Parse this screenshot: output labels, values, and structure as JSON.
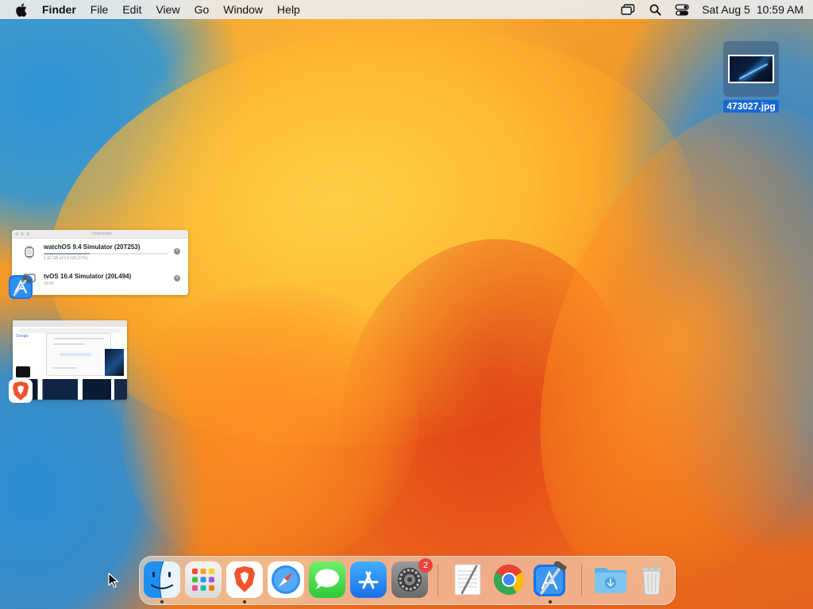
{
  "menubar": {
    "app_name": "Finder",
    "menus": [
      "File",
      "Edit",
      "View",
      "Go",
      "Window",
      "Help"
    ],
    "status_icons": [
      "screen-mirroring-icon",
      "spotlight-search-icon",
      "control-center-icon"
    ],
    "clock": {
      "date": "Sat Aug 5",
      "time": "10:59 AM"
    }
  },
  "desktop": {
    "file": {
      "name": "473027.jpg",
      "icon": "image-thumbnail-icon"
    }
  },
  "minimized_windows": {
    "downloads": {
      "title": "Downloads",
      "items": [
        {
          "name": "watchOS 9.4 Simulator (20T253)",
          "detail": "1.32 GB of 3.6 GB (37%)",
          "progress": 0.37,
          "icon": "apple-watch-icon"
        },
        {
          "name": "tvOS 16.4 Simulator (20L494)",
          "detail": "00:00",
          "progress": 0.0,
          "icon": "apple-tv-icon"
        }
      ],
      "app_badge": "xcode-icon"
    },
    "browser": {
      "logo_text": "Google",
      "app_badge": "brave-icon"
    }
  },
  "dock": {
    "apps": [
      {
        "name": "Finder",
        "icon": "finder-icon",
        "running": true
      },
      {
        "name": "Launchpad",
        "icon": "launchpad-icon",
        "running": false
      },
      {
        "name": "Brave Browser",
        "icon": "brave-icon",
        "running": true
      },
      {
        "name": "Safari",
        "icon": "safari-icon",
        "running": false
      },
      {
        "name": "Messages",
        "icon": "messages-icon",
        "running": false
      },
      {
        "name": "App Store",
        "icon": "app-store-icon",
        "running": false
      },
      {
        "name": "System Settings",
        "icon": "system-settings-icon",
        "running": false,
        "badge": "2"
      },
      {
        "name": "TextEdit",
        "icon": "textedit-icon",
        "running": false
      },
      {
        "name": "Google Chrome",
        "icon": "chrome-icon",
        "running": false
      },
      {
        "name": "Xcode",
        "icon": "xcode-icon",
        "running": true
      },
      {
        "name": "Downloads",
        "icon": "downloads-folder-icon",
        "running": false
      },
      {
        "name": "Trash",
        "icon": "trash-icon",
        "running": false
      }
    ]
  },
  "colors": {
    "menubar_bg": "#ececec",
    "selection_blue": "#1967d2",
    "badge_red": "#e8453c",
    "wallpaper_orange": "#f59a1c",
    "wallpaper_blue": "#2a8fd6"
  }
}
